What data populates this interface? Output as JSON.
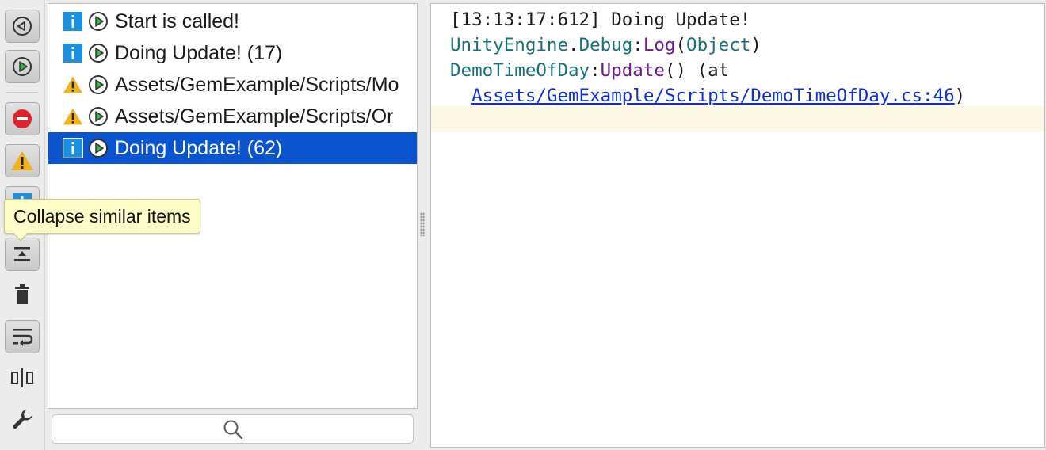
{
  "toolbar": {
    "buttons": [
      {
        "name": "unity-icon",
        "toggled": true
      },
      {
        "name": "play-icon",
        "toggled": true
      },
      {
        "name": "error-filter-icon",
        "toggled": true
      },
      {
        "name": "warning-filter-icon",
        "toggled": true
      },
      {
        "name": "info-filter-icon",
        "toggled": true
      },
      {
        "name": "collapse-icon",
        "toggled": true
      },
      {
        "name": "trash-icon",
        "toggled": false
      },
      {
        "name": "soft-wrap-icon",
        "toggled": true
      },
      {
        "name": "split-view-icon",
        "toggled": false
      },
      {
        "name": "wrench-icon",
        "toggled": false
      }
    ],
    "tooltip": "Collapse similar items"
  },
  "log": {
    "rows": [
      {
        "type": "info",
        "text": "Start is called!",
        "selected": false
      },
      {
        "type": "info",
        "text": "Doing Update! (17)",
        "selected": false
      },
      {
        "type": "warning",
        "text": "Assets/GemExample/Scripts/Mo",
        "selected": false
      },
      {
        "type": "warning",
        "text": "Assets/GemExample/Scripts/Or",
        "selected": false
      },
      {
        "type": "info",
        "text": "Doing Update! (62)",
        "selected": true
      }
    ]
  },
  "search": {
    "icon": "search-icon"
  },
  "detail": {
    "line1": "[13:13:17:612] Doing Update!",
    "line2": {
      "ns": "UnityEngine",
      "dot": ".",
      "cls": "Debug",
      "colon": ":",
      "method": "Log",
      "open": "(",
      "arg": "Object",
      "close": ")"
    },
    "line3": {
      "cls": "DemoTimeOfDay",
      "colon": ":",
      "method": "Update",
      "rest": "() (at"
    },
    "line4": {
      "link": "Assets/GemExample/Scripts/DemoTimeOfDay.cs:46",
      "close": ")"
    }
  },
  "colors": {
    "selection": "#0a54d0",
    "info": "#1b8fe0",
    "warning": "#f1b21b",
    "error": "#e0242c",
    "play": "#3bb54a"
  }
}
